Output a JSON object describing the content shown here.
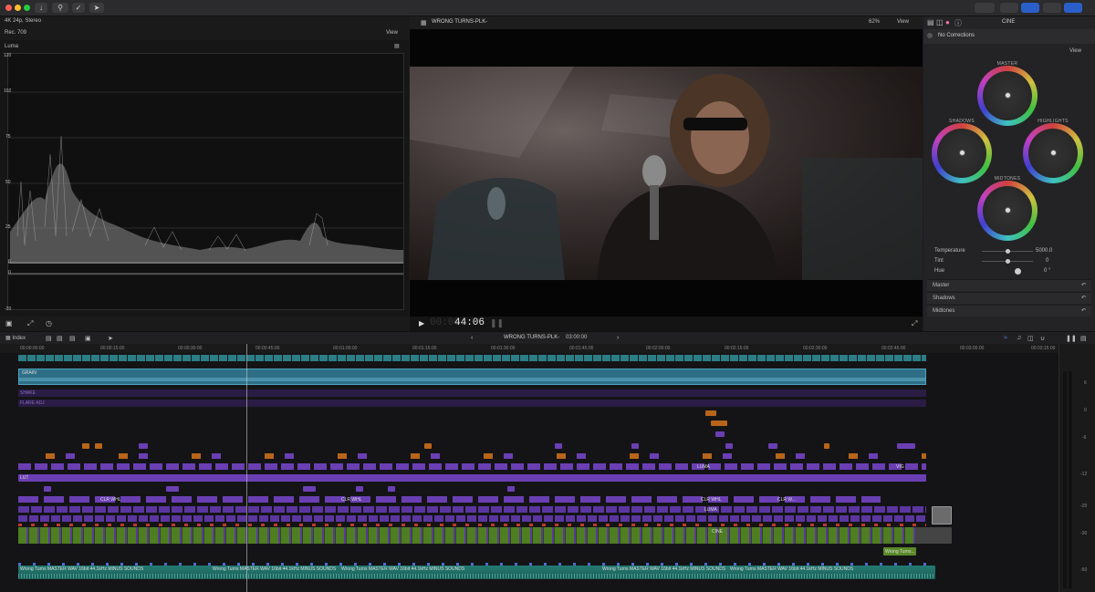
{
  "toolbar": {
    "close": "#ff5f57",
    "minimize": "#febc2e",
    "zoom": "#28c840"
  },
  "scopes": {
    "format": "4K 24p, Stereo",
    "colorspace": "Rec. 709",
    "view_label": "View",
    "mode": "Luma",
    "ticks": [
      "120",
      "102",
      "75",
      "50",
      "25",
      "6",
      "0",
      "-20"
    ]
  },
  "viewer": {
    "title": "WRONG TURNS-PLK-",
    "zoom": "62%",
    "view_label": "View",
    "timecode": "44:06"
  },
  "inspector": {
    "title": "CINE",
    "corrections": "No Corrections",
    "view_label": "View",
    "wheels": {
      "master": "MASTER",
      "shadows": "SHADOWS",
      "highlights": "HIGHLIGHTS",
      "midtones": "MIDTONES"
    },
    "params": [
      {
        "name": "Temperature",
        "value": "5000.0"
      },
      {
        "name": "Tint",
        "value": "0"
      },
      {
        "name": "Hue",
        "value": "0 °"
      }
    ],
    "sections": [
      "Master",
      "Shadows",
      "Midtones"
    ]
  },
  "timeline": {
    "index_label": "Index",
    "project": "WRONG TURNS-PLK-",
    "duration": "03:00:00",
    "ruler": [
      "00:00:00:00",
      "00:00:15:00",
      "00:00:30:00",
      "00:00:45:00",
      "00:01:00:00",
      "00:01:15:00",
      "00:01:30:00",
      "00:01:45:00",
      "00:02:00:00",
      "00:02:15:00",
      "00:02:30:00",
      "00:02:45:00",
      "00:03:00:00",
      "00:03:15:00"
    ],
    "lanes": {
      "grain": "GRAIN",
      "shake": "SHAKE",
      "flare": "FLARE ADJ",
      "lut": "LUT"
    },
    "audio_clip": "Wrong Turns MASTER WAV 16bit 44.1kHz MINUS SOUNDS",
    "wrong_turns_clip": "Wrong Turns...",
    "clip_tags": [
      "CINE",
      "CLR WHL",
      "LUMA",
      "VIG",
      "PW",
      "CLR W...",
      "FL...",
      "CU..."
    ]
  },
  "meters": {
    "scale": [
      "6",
      "0",
      "-6",
      "-12",
      "-20",
      "-30",
      "-50"
    ]
  },
  "colors": {
    "accent": "#1d7cf2",
    "purple": "#6b3fb4",
    "teal": "#2a8a8a",
    "orange": "#b8651a",
    "green": "#5a8a2a"
  }
}
